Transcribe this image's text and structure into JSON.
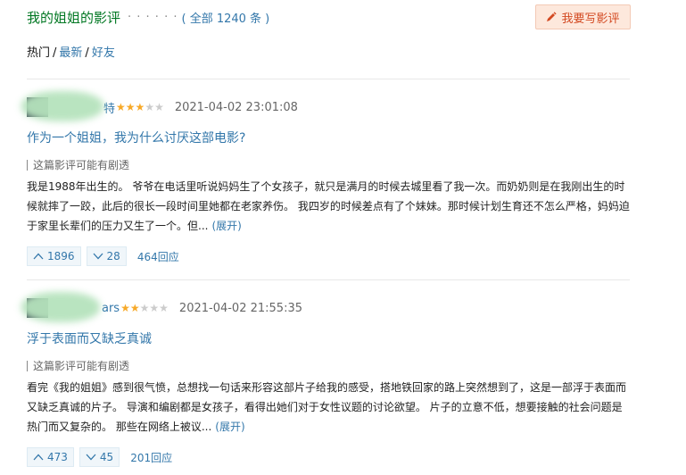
{
  "header": {
    "title": "我的姐姐的影评",
    "dots": "· · · · · ·",
    "count_text": "( 全部 1240 条 )",
    "write_button": "我要写影评"
  },
  "tabs": [
    {
      "label": "热门",
      "active": true
    },
    {
      "label": "最新",
      "active": false
    },
    {
      "label": "好友",
      "active": false
    }
  ],
  "tab_sep": "/",
  "reviews": [
    {
      "username": "特",
      "rating": 3,
      "max_rating": 5,
      "time": "2021-04-02 23:01:08",
      "title": "作为一个姐姐，我为什么讨厌这部电影?",
      "spoiler": "这篇影评可能有剧透",
      "content": "我是1988年出生的。 爷爷在电话里听说妈妈生了个女孩子，就只是满月的时候去城里看了我一次。而奶奶则是在我刚出生的时候就摔了一跤，此后的很长一段时间里她都在老家养伤。 我四岁的时候差点有了个妹妹。那时候计划生育还不怎么严格，妈妈迫于家里长辈们的压力又生了一个。但...",
      "expand": "(展开)",
      "upvotes": "1896",
      "downvotes": "28",
      "replies": "464回应"
    },
    {
      "username": "ars",
      "rating": 2,
      "max_rating": 5,
      "time": "2021-04-02 21:55:35",
      "title": "浮于表面而又缺乏真诚",
      "spoiler": "这篇影评可能有剧透",
      "content": "看完《我的姐姐》感到很气愤，总想找一句话来形容这部片子给我的感受，搭地铁回家的路上突然想到了，这是一部浮于表面而又缺乏真诚的片子。 导演和编剧都是女孩子，看得出她们对于女性议题的讨论欲望。 片子的立意不低，想要接触的社会问题是热门而又复杂的。 那些在网络上被议...",
      "expand": "(展开)",
      "upvotes": "473",
      "downvotes": "45",
      "replies": "201回应"
    }
  ],
  "colors": {
    "title_green": "#007722",
    "link_blue": "#3377aa",
    "star_on": "#f7a928",
    "button_bg": "#fde8dc"
  }
}
